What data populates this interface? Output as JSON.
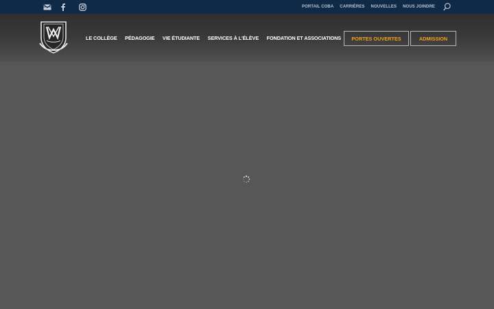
{
  "topbar": {
    "social": [
      {
        "icon": "mail-icon"
      },
      {
        "icon": "facebook-icon"
      },
      {
        "icon": "instagram-icon"
      }
    ],
    "links": [
      "PORTAIL COBA",
      "CARRIÈRES",
      "NOUVELLES",
      "NOUS JOINDRE"
    ]
  },
  "nav": {
    "items": [
      "LE COLLÈGE",
      "PÉDAGOGIE",
      "VIE ÉTUDIANTE",
      "SERVICES À L'ÉLÈVE",
      "FONDATION ET ASSOCIATIONS"
    ],
    "cta_open": "PORTES OUVERTES",
    "cta_admission": "ADMISSION"
  },
  "colors": {
    "topbar_bg": "#0f2a47",
    "accent": "#f2a31b",
    "page_bg": "#575757"
  }
}
